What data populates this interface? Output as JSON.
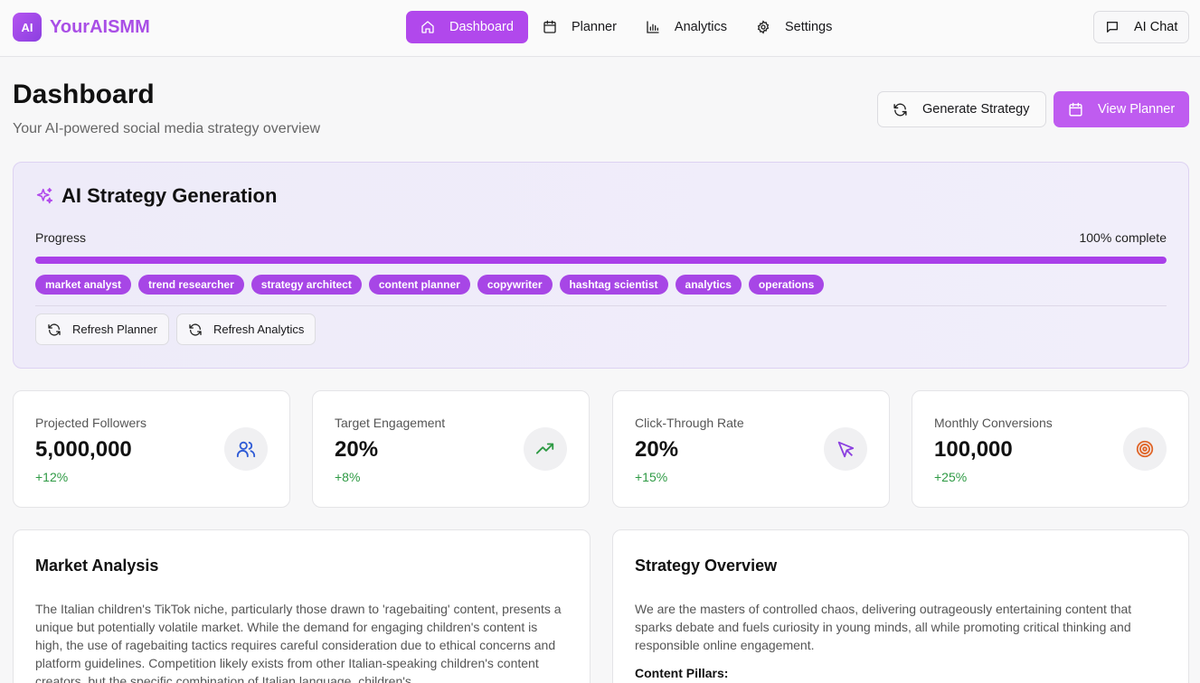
{
  "app": {
    "logo_badge": "AI",
    "name": "YourAISMM",
    "brand_color": "#a94ee6"
  },
  "nav": {
    "items": [
      {
        "label": "Dashboard",
        "icon": "home-icon",
        "active": true
      },
      {
        "label": "Planner",
        "icon": "calendar-icon"
      },
      {
        "label": "Analytics",
        "icon": "bar-chart-icon"
      },
      {
        "label": "Settings",
        "icon": "gear-icon"
      }
    ],
    "chat_label": "AI Chat"
  },
  "header": {
    "title": "Dashboard",
    "subtitle": "Your AI-powered social media strategy overview",
    "generate_label": "Generate Strategy",
    "view_planner_label": "View Planner"
  },
  "strategy": {
    "title": "AI Strategy Generation",
    "progress_label": "Progress",
    "progress_text": "100% complete",
    "progress_value": 100,
    "agents": [
      "market analyst",
      "trend researcher",
      "strategy architect",
      "content planner",
      "copywriter",
      "hashtag scientist",
      "analytics",
      "operations"
    ],
    "refresh_planner_label": "Refresh Planner",
    "refresh_analytics_label": "Refresh Analytics"
  },
  "stats": [
    {
      "label": "Projected Followers",
      "value": "5,000,000",
      "change": "+12%",
      "icon": "users-icon",
      "icon_color": "#2f5bd6"
    },
    {
      "label": "Target Engagement",
      "value": "20%",
      "change": "+8%",
      "icon": "trending-up-icon",
      "icon_color": "#2e9a44"
    },
    {
      "label": "Click-Through Rate",
      "value": "20%",
      "change": "+15%",
      "icon": "cursor-icon",
      "icon_color": "#8b3fe0"
    },
    {
      "label": "Monthly Conversions",
      "value": "100,000",
      "change": "+25%",
      "icon": "target-icon",
      "icon_color": "#e0672b"
    }
  ],
  "market": {
    "title": "Market Analysis",
    "body": "The Italian children's TikTok niche, particularly those drawn to 'ragebaiting' content, presents a unique but potentially volatile market. While the demand for engaging children's content is high, the use of ragebaiting tactics requires careful consideration due to ethical concerns and platform guidelines. Competition likely exists from other Italian-speaking children's content creators, but the specific combination of Italian language, children's"
  },
  "overview": {
    "title": "Strategy Overview",
    "body": "We are the masters of controlled chaos, delivering outrageously entertaining content that sparks debate and fuels curiosity in young minds, all while promoting critical thinking and responsible online engagement.",
    "pillars_label": "Content Pillars:"
  }
}
